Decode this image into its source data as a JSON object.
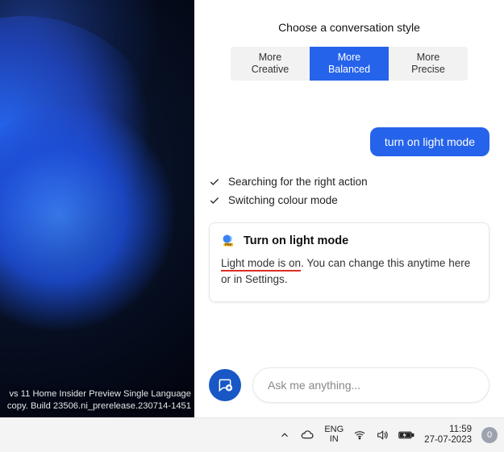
{
  "desktop": {
    "watermark_line1": "vs 11 Home Insider Preview Single Language",
    "watermark_line2": "copy. Build 23506.ni_prerelease.230714-1451"
  },
  "panel": {
    "title": "Choose a conversation style",
    "styles": {
      "creative": {
        "line1": "More",
        "line2": "Creative"
      },
      "balanced": {
        "line1": "More",
        "line2": "Balanced"
      },
      "precise": {
        "line1": "More",
        "line2": "Precise"
      }
    },
    "user_message": "turn on light mode",
    "progress": {
      "item1": "Searching for the right action",
      "item2": "Switching colour mode"
    },
    "card": {
      "title": "Turn on light mode",
      "emphasis": "Light mode is on",
      "rest": ". You can change this anytime here or in Settings."
    },
    "composer": {
      "placeholder": "Ask me anything..."
    }
  },
  "taskbar": {
    "lang_top": "ENG",
    "lang_bottom": "IN",
    "time": "11:59",
    "date": "27-07-2023",
    "notif_count": "0"
  }
}
